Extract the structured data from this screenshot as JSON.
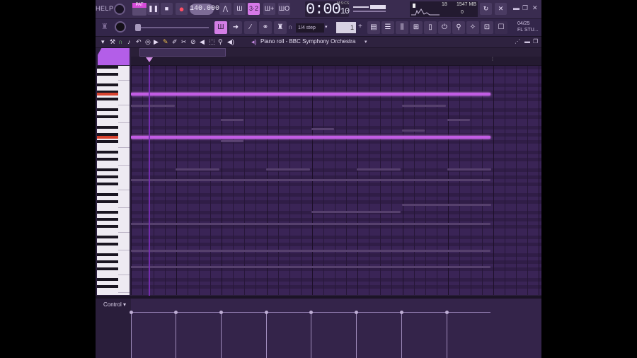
{
  "toolbar": {
    "help_label": "HELP",
    "pattern_tag": "PAT",
    "tempo": "140.000",
    "time_display": "0:00",
    "time_sub": "10",
    "time_unit": "M:S:CS",
    "cpu_value": "18",
    "mem_value": "1547 MB",
    "voices_value": "0",
    "snap_label": "1/4 step",
    "step_value": "1",
    "studio_date": "04/25",
    "studio_label": "FL STU..."
  },
  "piano_roll": {
    "title": "Piano roll - BBC Symphony Orchestra",
    "control_label": "Control"
  },
  "colors": {
    "accent": "#c25ce4",
    "background": "#2b1f3d",
    "key_highlight": "#d8422f"
  },
  "icons": [
    "help-icon",
    "master-knob-icon",
    "play-icon",
    "stop-icon",
    "record-icon",
    "metronome-icon",
    "wave-icon",
    "pattern-icon",
    "song-icon",
    "undo-icon",
    "settings-icon",
    "close-icon",
    "minimize-icon",
    "maximize-icon",
    "piano-roll-icon",
    "arrow-icon",
    "draw-icon",
    "link-icon",
    "stamp-icon",
    "magnet-icon",
    "mixer-icon",
    "channel-rack-icon",
    "browser-icon",
    "plugin-icon",
    "pencil-icon",
    "brush-icon",
    "delete-icon",
    "mute-icon",
    "slice-icon",
    "select-icon",
    "zoom-icon",
    "speaker-icon"
  ]
}
